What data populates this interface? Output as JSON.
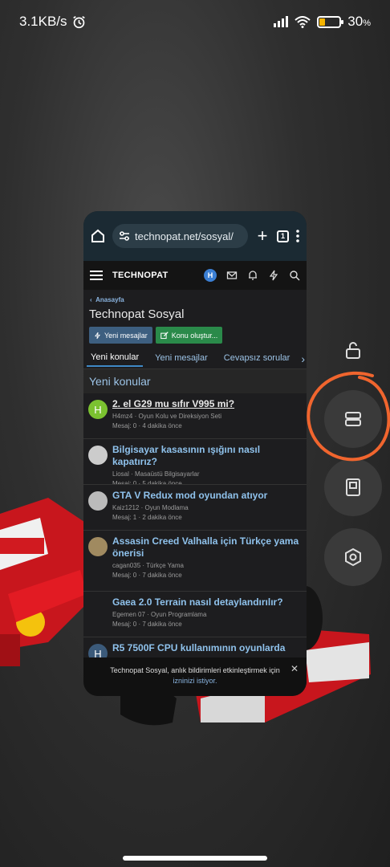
{
  "status": {
    "speed": "3.1KB/s",
    "battery_pct": "30",
    "battery_sign": "%",
    "battery_level": 0.3
  },
  "browser": {
    "url": "technopat.net/sosyal/",
    "tab_count": "1"
  },
  "site": {
    "logo": "TECHNOPAT",
    "avatar_letter": "H",
    "breadcrumb": "Anasayfa",
    "page_title": "Technopat Sosyal",
    "btn_new_messages": "Yeni mesajlar",
    "btn_create_topic": "Konu oluştur...",
    "tabs": [
      "Yeni konular",
      "Yeni mesajlar",
      "Cevapsız sorular"
    ],
    "section_title": "Yeni konular"
  },
  "threads": [
    {
      "title": "2. el G29 mu sıfır V995 mi?",
      "author": "H4mz4",
      "forum": "Oyun Kolu ve Direksiyon Seti",
      "replies": "Mesaj: 0",
      "time": "4 dakika önce",
      "avatar_letter": "H",
      "avatar_color": "#7bc230"
    },
    {
      "title": "Bilgisayar kasasının ışığını nasıl kapatırız?",
      "author": "Liosal",
      "forum": "Masaüstü Bilgisayarlar",
      "replies": "Mesaj: 0",
      "time": "5 dakika önce",
      "avatar_color": "#cccccc"
    },
    {
      "title": "GTA V Redux mod oyundan atıyor",
      "author": "Kaiz1212",
      "forum": "Oyun Modlama",
      "replies": "Mesaj: 1",
      "time": "2 dakika önce",
      "avatar_color": "#bbbbbb"
    },
    {
      "title": "Assasin Creed Valhalla için Türkçe yama önerisi",
      "author": "cagan035",
      "forum": "Türkçe Yama",
      "replies": "Mesaj: 0",
      "time": "7 dakika önce",
      "avatar_color": "#a08a60"
    },
    {
      "title": "Gaea 2.0 Terrain nasıl detaylandırılır?",
      "author": "Egemen 07",
      "forum": "Oyun Programlama",
      "replies": "Mesaj: 0",
      "time": "7 dakika önce",
      "avatar_color": ""
    },
    {
      "title": "R5 7500F CPU kullanımının oyunlarda",
      "author": "",
      "forum": "",
      "replies": "",
      "time": "",
      "avatar_letter": "H",
      "avatar_color": "#3b5a7a"
    }
  ],
  "toast": {
    "text": "Technopat Sosyal, anlık bildirimleri etkinleştirmek için",
    "link": "izninizi istiyor."
  },
  "side_buttons": [
    "unlock-icon",
    "split-screen-icon",
    "floating-window-icon",
    "settings-icon"
  ]
}
